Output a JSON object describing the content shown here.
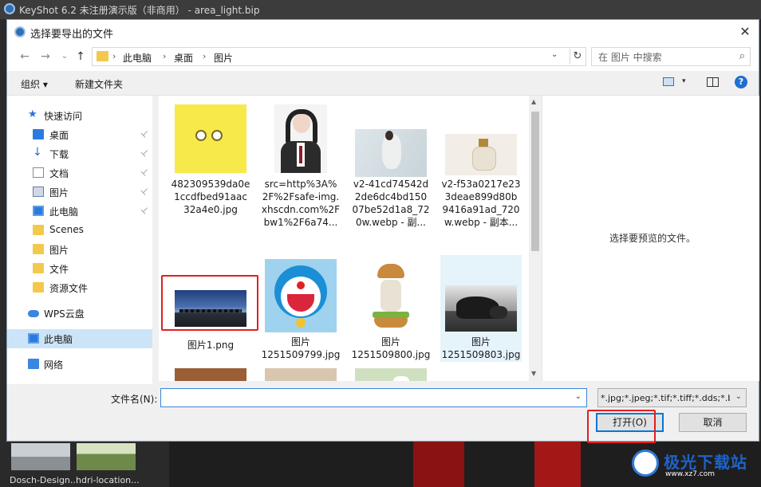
{
  "app": {
    "title": "KeyShot 6.2 未注册演示版（非商用） - area_light.bip",
    "bottom_items": [
      {
        "label": "Dosch-Design..."
      },
      {
        "label": "hdri-location..."
      }
    ]
  },
  "watermark": {
    "text": "极光下载站",
    "url": "www.xz7.com"
  },
  "dialog": {
    "title": "选择要导出的文件",
    "close_glyph": "✕",
    "nav": {
      "back_glyph": "←",
      "forward_glyph": "→",
      "dropdown_glyph": "⌄",
      "up_glyph": "↑",
      "breadcrumb": [
        "此电脑",
        "桌面",
        "图片"
      ],
      "sep_glyph": "›",
      "refresh_glyph": "↻"
    },
    "search": {
      "placeholder": "在 图片 中搜索",
      "icon_glyph": "⌕"
    },
    "toolbar": {
      "organize": "组织 ▾",
      "new_folder": "新建文件夹",
      "view_dd": "▾",
      "help": "?"
    },
    "sidebar": [
      {
        "label": "快速访问",
        "icon": "star-icon",
        "pinned": false,
        "selected": false
      },
      {
        "label": "桌面",
        "icon": "desktop-icon",
        "pinned": true,
        "selected": false
      },
      {
        "label": "下载",
        "icon": "download-icon",
        "pinned": true,
        "selected": false
      },
      {
        "label": "文档",
        "icon": "document-icon",
        "pinned": true,
        "selected": false
      },
      {
        "label": "图片",
        "icon": "pictures-icon",
        "pinned": true,
        "selected": false
      },
      {
        "label": "此电脑",
        "icon": "computer-icon",
        "pinned": true,
        "selected": false
      },
      {
        "label": "Scenes",
        "icon": "folder-icon",
        "pinned": false,
        "selected": false
      },
      {
        "label": "图片",
        "icon": "folder-icon",
        "pinned": false,
        "selected": false
      },
      {
        "label": "文件",
        "icon": "folder-icon",
        "pinned": false,
        "selected": false
      },
      {
        "label": "资源文件",
        "icon": "folder-icon",
        "pinned": false,
        "selected": false
      },
      {
        "label": "WPS云盘",
        "icon": "cloud-icon",
        "pinned": false,
        "selected": false
      },
      {
        "label": "此电脑",
        "icon": "computer-icon",
        "pinned": false,
        "selected": true
      },
      {
        "label": "网络",
        "icon": "network-icon",
        "pinned": false,
        "selected": false
      }
    ],
    "pin_glyph": "📌",
    "files": [
      {
        "name": "482309539da0e\n1ccdfbed91aac\n32a4e0.jpg",
        "thumb": "spongebob"
      },
      {
        "name": "src=http%3A%\n2F%2Fsafe-img.\nxhscdn.com%2F\nbw1%2F6a74...",
        "thumb": "portrait"
      },
      {
        "name": "v2-41cd74542d\n2de6dc4bd150\n07be52d1a8_72\n0w.webp - 副...",
        "thumb": "woman"
      },
      {
        "name": "v2-f53a0217e23\n3deae899d80b\n9416a91ad_720\nw.webp - 副本...",
        "thumb": "bottle"
      },
      {
        "name": "图片1.png",
        "thumb": "skyline"
      },
      {
        "name": "图片\n1251509799.jpg",
        "thumb": "doraemon"
      },
      {
        "name": "图片\n1251509800.jpg",
        "thumb": "burger"
      },
      {
        "name": "图片\n1251509803.jpg",
        "thumb": "rocks",
        "selected": true
      },
      {
        "name": "",
        "thumb": "leather"
      },
      {
        "name": "",
        "thumb": "beige"
      },
      {
        "name": "",
        "thumb": "green"
      }
    ],
    "preview_message": "选择要预览的文件。",
    "filename_label": "文件名(N):",
    "filename_value": "",
    "filetype_value": "*.jpg;*.jpeg;*.tif;*.tiff;*.dds;*.b",
    "open_button": "打开(O)",
    "cancel_button": "取消"
  }
}
